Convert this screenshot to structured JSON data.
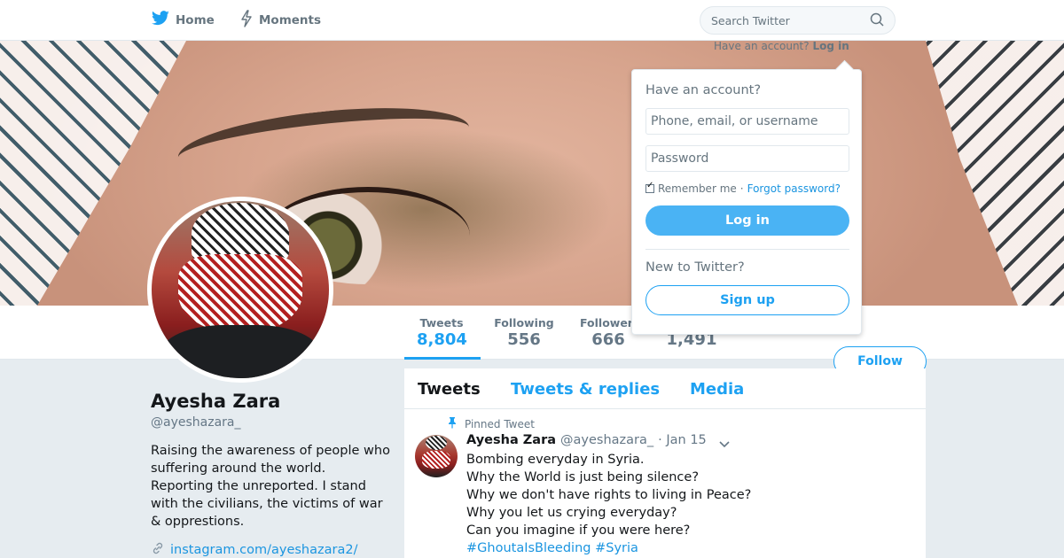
{
  "nav": {
    "home_label": "Home",
    "moments_label": "Moments",
    "search_placeholder": "Search Twitter",
    "have_account_text": "Have an account?",
    "login_link": "Log in",
    "home_icon": "bird-icon",
    "moments_icon": "lightning-icon"
  },
  "stats": {
    "tweets_label": "Tweets",
    "tweets_value": "8,804",
    "following_label": "Following",
    "following_value": "556",
    "followers_label": "Followers",
    "followers_value": "666",
    "likes_value": "1,491"
  },
  "follow_label": "Follow",
  "profile": {
    "name": "Ayesha Zara",
    "handle": "@ayeshazara_",
    "bio": "Raising the awareness of people who suffering around the world. Reporting the unreported. I stand with the civilians, the victims of war & opprestions.",
    "link": "instagram.com/ayeshazara2/"
  },
  "timeline": {
    "tabs": [
      "Tweets",
      "Tweets & replies",
      "Media"
    ],
    "pinned_label": "Pinned Tweet",
    "tweet": {
      "name": "Ayesha Zara",
      "handle": "@ayeshazara_",
      "date": "· Jan 15",
      "lines": [
        "Bombing everyday in Syria.",
        "Why the World is just being silence?",
        "Why we don't have rights to living in Peace?",
        "Why you let us crying everyday?",
        "Can you imagine if you were here?"
      ],
      "hashtags": "#GhoutaIsBleeding #Syria"
    }
  },
  "login_box": {
    "title": "Have an account?",
    "username_placeholder": "Phone, email, or username",
    "password_placeholder": "Password",
    "remember_label": "Remember me",
    "separator": "·",
    "forgot_label": "Forgot password?",
    "login_button": "Log in",
    "new_label": "New to Twitter?",
    "signup_button": "Sign up"
  },
  "colors": {
    "accent": "#1da1f2",
    "login_button_bg": "#4ab3f4",
    "link": "#1b95e0"
  }
}
